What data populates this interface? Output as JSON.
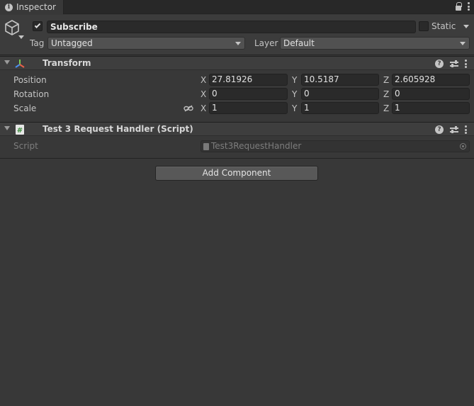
{
  "tab": {
    "title": "Inspector"
  },
  "object": {
    "name": "Subscribe",
    "active": true,
    "static_label": "Static",
    "static": false,
    "tag_label": "Tag",
    "tag_value": "Untagged",
    "layer_label": "Layer",
    "layer_value": "Default"
  },
  "transform": {
    "title": "Transform",
    "rows": [
      {
        "label": "Position",
        "x": "27.81926",
        "y": "10.5187",
        "z": "2.605928"
      },
      {
        "label": "Rotation",
        "x": "0",
        "y": "0",
        "z": "0"
      },
      {
        "label": "Scale",
        "x": "1",
        "y": "1",
        "z": "1"
      }
    ],
    "axis_labels": {
      "x": "X",
      "y": "Y",
      "z": "Z"
    }
  },
  "script_component": {
    "title": "Test 3 Request Handler (Script)",
    "script_label": "Script",
    "script_value": "Test3RequestHandler"
  },
  "add_component_label": "Add Component",
  "icons": {
    "tab": "info-icon",
    "lock": "lock-icon",
    "menu": "kebab-menu-icon",
    "gameobject": "cube-icon",
    "transform": "transform-axes-icon",
    "script": "csharp-script-icon",
    "help": "help-icon",
    "presets": "presets-icon",
    "constrain": "constrain-proportions-icon",
    "target": "object-picker-icon"
  },
  "colors": {
    "background": "#383838",
    "header": "#3c3c3c",
    "field": "#2a2a2a",
    "button": "#585858"
  }
}
